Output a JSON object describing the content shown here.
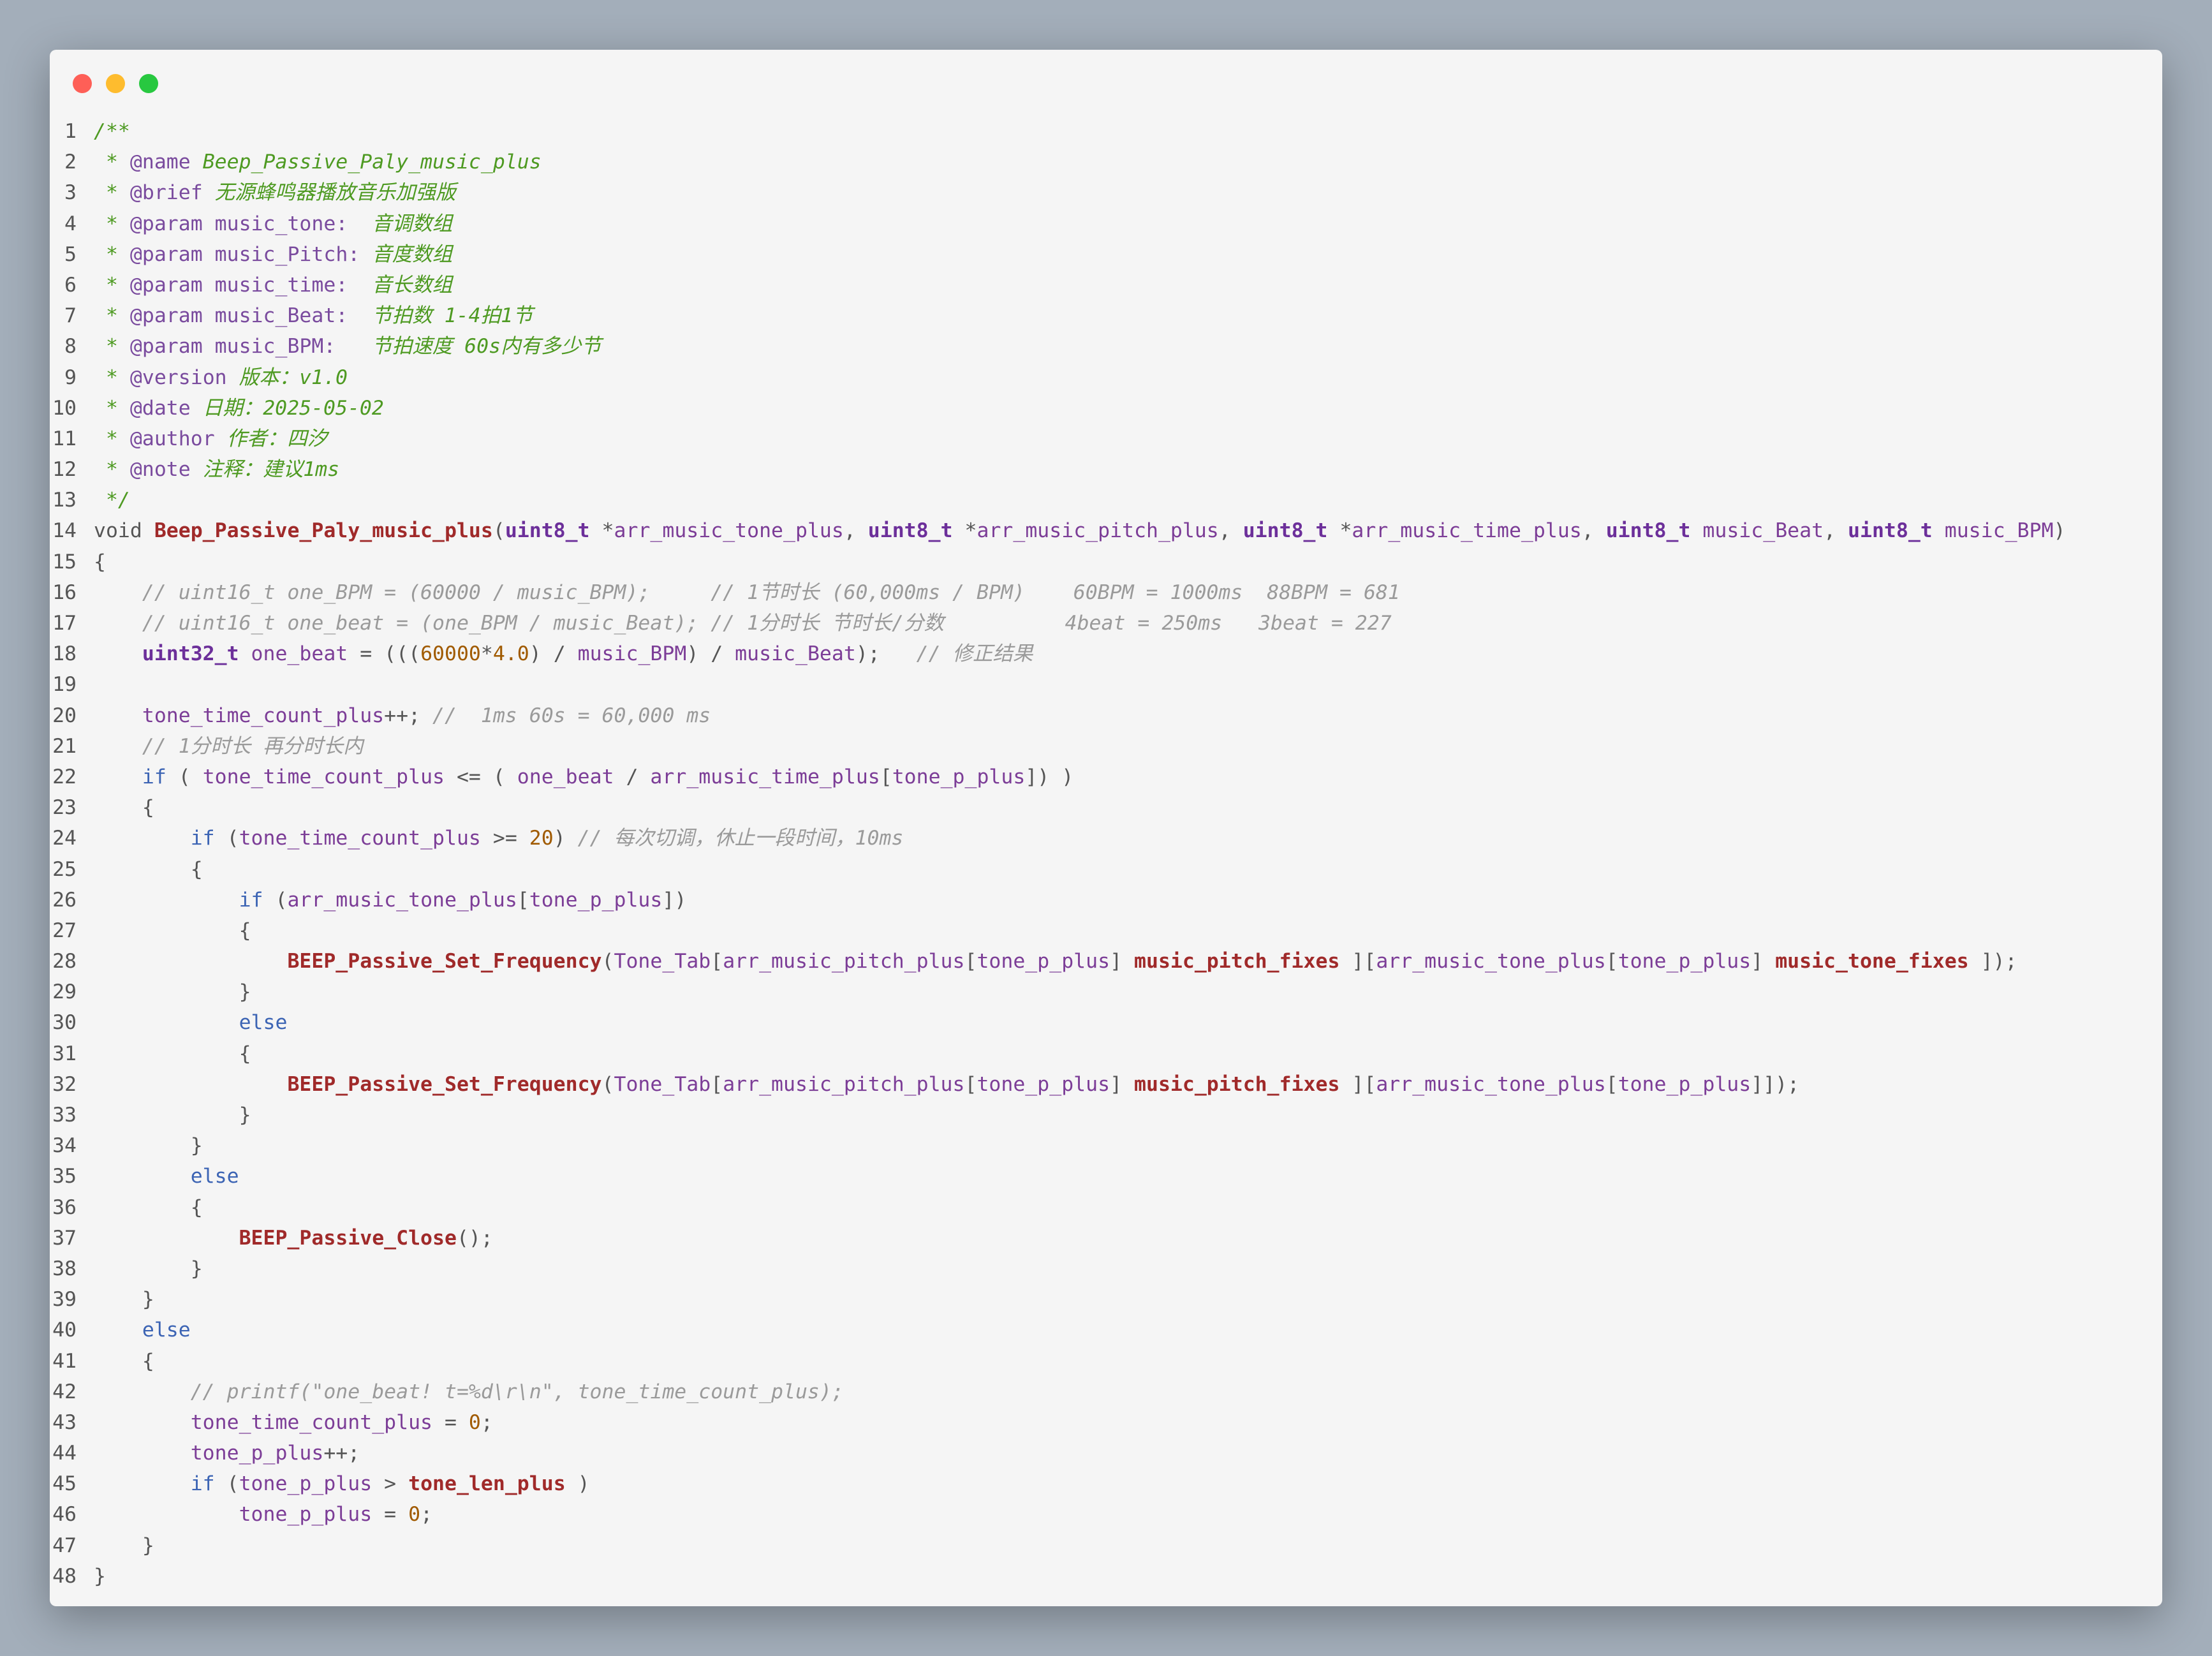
{
  "window": {
    "controls": [
      "close",
      "minimize",
      "zoom"
    ]
  },
  "colors": {
    "comment_doc": "#4e9a22",
    "comment_gray": "#9a9a9a",
    "keyword": "#3c64b4",
    "type": "#6c2f9a",
    "function": "#a02a2a",
    "identifier": "#7c3d97",
    "number": "#a05a00"
  },
  "code": {
    "lines": [
      [
        [
          "/**",
          "cm"
        ]
      ],
      [
        [
          " * ",
          "cm"
        ],
        [
          "@name",
          "tag"
        ],
        [
          " Beep_Passive_Paly_music_plus",
          "cm"
        ]
      ],
      [
        [
          " * ",
          "cm"
        ],
        [
          "@brief",
          "tag"
        ],
        [
          " 无源蜂鸣器播放音乐加强版",
          "cm"
        ]
      ],
      [
        [
          " * ",
          "cm"
        ],
        [
          "@param",
          "tag"
        ],
        [
          " music_tone:",
          "tag"
        ],
        [
          "  音调数组",
          "cm"
        ]
      ],
      [
        [
          " * ",
          "cm"
        ],
        [
          "@param",
          "tag"
        ],
        [
          " music_Pitch:",
          "tag"
        ],
        [
          " 音度数组",
          "cm"
        ]
      ],
      [
        [
          " * ",
          "cm"
        ],
        [
          "@param",
          "tag"
        ],
        [
          " music_time:",
          "tag"
        ],
        [
          "  音长数组",
          "cm"
        ]
      ],
      [
        [
          " * ",
          "cm"
        ],
        [
          "@param",
          "tag"
        ],
        [
          " music_Beat:",
          "tag"
        ],
        [
          "  节拍数 1-4拍1节",
          "cm"
        ]
      ],
      [
        [
          " * ",
          "cm"
        ],
        [
          "@param",
          "tag"
        ],
        [
          " music_BPM:",
          "tag"
        ],
        [
          "   节拍速度 60s内有多少节",
          "cm"
        ]
      ],
      [
        [
          " * ",
          "cm"
        ],
        [
          "@version",
          "tag"
        ],
        [
          " 版本：v1.0",
          "cm"
        ]
      ],
      [
        [
          " * ",
          "cm"
        ],
        [
          "@date",
          "tag"
        ],
        [
          " 日期：2025-05-02",
          "cm"
        ]
      ],
      [
        [
          " * ",
          "cm"
        ],
        [
          "@author",
          "tag"
        ],
        [
          " 作者：四汐",
          "cm"
        ]
      ],
      [
        [
          " * ",
          "cm"
        ],
        [
          "@note",
          "tag"
        ],
        [
          " 注释：建议1ms",
          "cm"
        ]
      ],
      [
        [
          " */",
          "cm"
        ]
      ],
      [
        [
          "void ",
          "p"
        ],
        [
          "Beep_Passive_Paly_music_plus",
          "fn"
        ],
        [
          "(",
          "p"
        ],
        [
          "uint8_t",
          "ty"
        ],
        [
          " *",
          "p"
        ],
        [
          "arr_music_tone_plus",
          "id"
        ],
        [
          ", ",
          "p"
        ],
        [
          "uint8_t",
          "ty"
        ],
        [
          " *",
          "p"
        ],
        [
          "arr_music_pitch_plus",
          "id"
        ],
        [
          ", ",
          "p"
        ],
        [
          "uint8_t",
          "ty"
        ],
        [
          " *",
          "p"
        ],
        [
          "arr_music_time_plus",
          "id"
        ],
        [
          ", ",
          "p"
        ],
        [
          "uint8_t",
          "ty"
        ],
        [
          " music_Beat",
          "id"
        ],
        [
          ", ",
          "p"
        ],
        [
          "uint8_t",
          "ty"
        ],
        [
          " music_BPM",
          "id"
        ],
        [
          ")",
          "p"
        ]
      ],
      [
        [
          "{",
          "p"
        ]
      ],
      [
        [
          "    ",
          "p"
        ],
        [
          "// uint16_t one_BPM = (60000 / music_BPM);     // 1节时长 (60,000ms / BPM)    60BPM = 1000ms  88BPM = 681",
          "cg"
        ]
      ],
      [
        [
          "    ",
          "p"
        ],
        [
          "// uint16_t one_beat = (one_BPM / music_Beat); // 1分时长 节时长/分数          4beat = 250ms   3beat = 227",
          "cg"
        ]
      ],
      [
        [
          "    ",
          "p"
        ],
        [
          "uint32_t",
          "ty"
        ],
        [
          " one_beat",
          "id"
        ],
        [
          " = (((",
          "p"
        ],
        [
          "60000",
          "nm"
        ],
        [
          "*",
          "p"
        ],
        [
          "4.0",
          "nm"
        ],
        [
          ") / ",
          "p"
        ],
        [
          "music_BPM",
          "id"
        ],
        [
          ") / ",
          "p"
        ],
        [
          "music_Beat",
          "id"
        ],
        [
          ");   ",
          "p"
        ],
        [
          "// 修正结果",
          "cg"
        ]
      ],
      [
        [
          "",
          "p"
        ]
      ],
      [
        [
          "    ",
          "p"
        ],
        [
          "tone_time_count_plus",
          "id"
        ],
        [
          "++; ",
          "p"
        ],
        [
          "//  1ms 60s = 60,000 ms",
          "cg"
        ]
      ],
      [
        [
          "    ",
          "p"
        ],
        [
          "// 1分时长 再分时长内",
          "cg"
        ]
      ],
      [
        [
          "    ",
          "p"
        ],
        [
          "if",
          "kw"
        ],
        [
          " ( ",
          "p"
        ],
        [
          "tone_time_count_plus",
          "id"
        ],
        [
          " <= ( ",
          "p"
        ],
        [
          "one_beat",
          "id"
        ],
        [
          " / ",
          "p"
        ],
        [
          "arr_music_time_plus",
          "id"
        ],
        [
          "[",
          "p"
        ],
        [
          "tone_p_plus",
          "id"
        ],
        [
          "]) )",
          "p"
        ]
      ],
      [
        [
          "    {",
          "p"
        ]
      ],
      [
        [
          "        ",
          "p"
        ],
        [
          "if",
          "kw"
        ],
        [
          " (",
          "p"
        ],
        [
          "tone_time_count_plus",
          "id"
        ],
        [
          " >= ",
          "p"
        ],
        [
          "20",
          "nm"
        ],
        [
          ") ",
          "p"
        ],
        [
          "// 每次切调，休止一段时间，10ms",
          "cg"
        ]
      ],
      [
        [
          "        {",
          "p"
        ]
      ],
      [
        [
          "            ",
          "p"
        ],
        [
          "if",
          "kw"
        ],
        [
          " (",
          "p"
        ],
        [
          "arr_music_tone_plus",
          "id"
        ],
        [
          "[",
          "p"
        ],
        [
          "tone_p_plus",
          "id"
        ],
        [
          "])",
          "p"
        ]
      ],
      [
        [
          "            {",
          "p"
        ]
      ],
      [
        [
          "                ",
          "p"
        ],
        [
          "BEEP_Passive_Set_Frequency",
          "fn"
        ],
        [
          "(",
          "p"
        ],
        [
          "Tone_Tab",
          "id"
        ],
        [
          "[",
          "p"
        ],
        [
          "arr_music_pitch_plus",
          "id"
        ],
        [
          "[",
          "p"
        ],
        [
          "tone_p_plus",
          "id"
        ],
        [
          "] ",
          "p"
        ],
        [
          "music_pitch_fixes",
          "fn"
        ],
        [
          " ][",
          "p"
        ],
        [
          "arr_music_tone_plus",
          "id"
        ],
        [
          "[",
          "p"
        ],
        [
          "tone_p_plus",
          "id"
        ],
        [
          "] ",
          "p"
        ],
        [
          "music_tone_fixes",
          "fn"
        ],
        [
          " ]);",
          "p"
        ]
      ],
      [
        [
          "            }",
          "p"
        ]
      ],
      [
        [
          "            ",
          "p"
        ],
        [
          "else",
          "kw"
        ]
      ],
      [
        [
          "            {",
          "p"
        ]
      ],
      [
        [
          "                ",
          "p"
        ],
        [
          "BEEP_Passive_Set_Frequency",
          "fn"
        ],
        [
          "(",
          "p"
        ],
        [
          "Tone_Tab",
          "id"
        ],
        [
          "[",
          "p"
        ],
        [
          "arr_music_pitch_plus",
          "id"
        ],
        [
          "[",
          "p"
        ],
        [
          "tone_p_plus",
          "id"
        ],
        [
          "] ",
          "p"
        ],
        [
          "music_pitch_fixes",
          "fn"
        ],
        [
          " ][",
          "p"
        ],
        [
          "arr_music_tone_plus",
          "id"
        ],
        [
          "[",
          "p"
        ],
        [
          "tone_p_plus",
          "id"
        ],
        [
          "]]);",
          "p"
        ]
      ],
      [
        [
          "            }",
          "p"
        ]
      ],
      [
        [
          "        }",
          "p"
        ]
      ],
      [
        [
          "        ",
          "p"
        ],
        [
          "else",
          "kw"
        ]
      ],
      [
        [
          "        {",
          "p"
        ]
      ],
      [
        [
          "            ",
          "p"
        ],
        [
          "BEEP_Passive_Close",
          "fn"
        ],
        [
          "();",
          "p"
        ]
      ],
      [
        [
          "        }",
          "p"
        ]
      ],
      [
        [
          "    }",
          "p"
        ]
      ],
      [
        [
          "    ",
          "p"
        ],
        [
          "else",
          "kw"
        ]
      ],
      [
        [
          "    {",
          "p"
        ]
      ],
      [
        [
          "        ",
          "p"
        ],
        [
          "// printf(\"one_beat! t=%d\\r\\n\", tone_time_count_plus);",
          "cg"
        ]
      ],
      [
        [
          "        ",
          "p"
        ],
        [
          "tone_time_count_plus",
          "id"
        ],
        [
          " = ",
          "p"
        ],
        [
          "0",
          "nm"
        ],
        [
          ";",
          "p"
        ]
      ],
      [
        [
          "        ",
          "p"
        ],
        [
          "tone_p_plus",
          "id"
        ],
        [
          "++;",
          "p"
        ]
      ],
      [
        [
          "        ",
          "p"
        ],
        [
          "if",
          "kw"
        ],
        [
          " (",
          "p"
        ],
        [
          "tone_p_plus",
          "id"
        ],
        [
          " > ",
          "p"
        ],
        [
          "tone_len_plus",
          "fn"
        ],
        [
          " )",
          "p"
        ]
      ],
      [
        [
          "            ",
          "p"
        ],
        [
          "tone_p_plus",
          "id"
        ],
        [
          " = ",
          "p"
        ],
        [
          "0",
          "nm"
        ],
        [
          ";",
          "p"
        ]
      ],
      [
        [
          "    }",
          "p"
        ]
      ],
      [
        [
          "}",
          "p"
        ]
      ]
    ]
  }
}
